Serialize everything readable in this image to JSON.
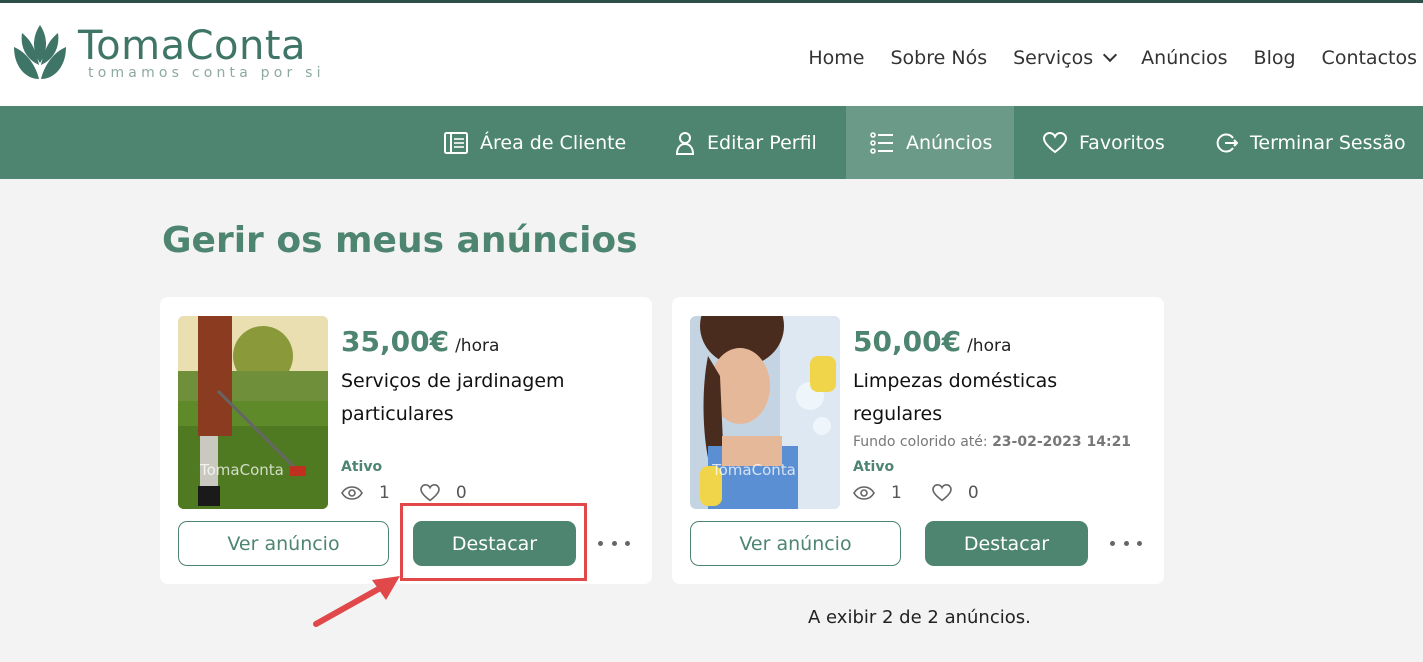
{
  "brand": {
    "name": "TomaConta",
    "tagline": "tomamos conta por si",
    "color": "#3f7566"
  },
  "main_nav": {
    "items": [
      "Home",
      "Sobre Nós",
      "Serviços",
      "Anúncios",
      "Blog",
      "Contactos"
    ]
  },
  "sub_nav": {
    "items": [
      {
        "label": "Área de Cliente",
        "icon": "dashboard-icon"
      },
      {
        "label": "Editar Perfil",
        "icon": "user-icon"
      },
      {
        "label": "Anúncios",
        "icon": "list-icon",
        "active": true
      },
      {
        "label": "Favoritos",
        "icon": "heart-icon"
      },
      {
        "label": "Terminar Sessão",
        "icon": "logout-icon"
      }
    ],
    "background": "#4d8571"
  },
  "page": {
    "title": "Gerir os meus anúncios",
    "count_text": "A exibir 2 de 2 anúncios."
  },
  "ads": [
    {
      "price": "35,00€",
      "unit": "/hora",
      "title": "Serviços de jardinagem particulares",
      "status": "Ativo",
      "views": "1",
      "likes": "0",
      "view_button": "Ver anúncio",
      "highlight_button": "Destacar",
      "image_watermark": "TomaConta"
    },
    {
      "price": "50,00€",
      "unit": "/hora",
      "title": "Limpezas domésticas regulares",
      "highlight_label": "Fundo colorido até:",
      "highlight_until": "23-02-2023 14:21",
      "status": "Ativo",
      "views": "1",
      "likes": "0",
      "view_button": "Ver anúncio",
      "highlight_button": "Destacar",
      "image_watermark": "TomaConta"
    }
  ],
  "annotation": {
    "color": "#e0484a"
  }
}
